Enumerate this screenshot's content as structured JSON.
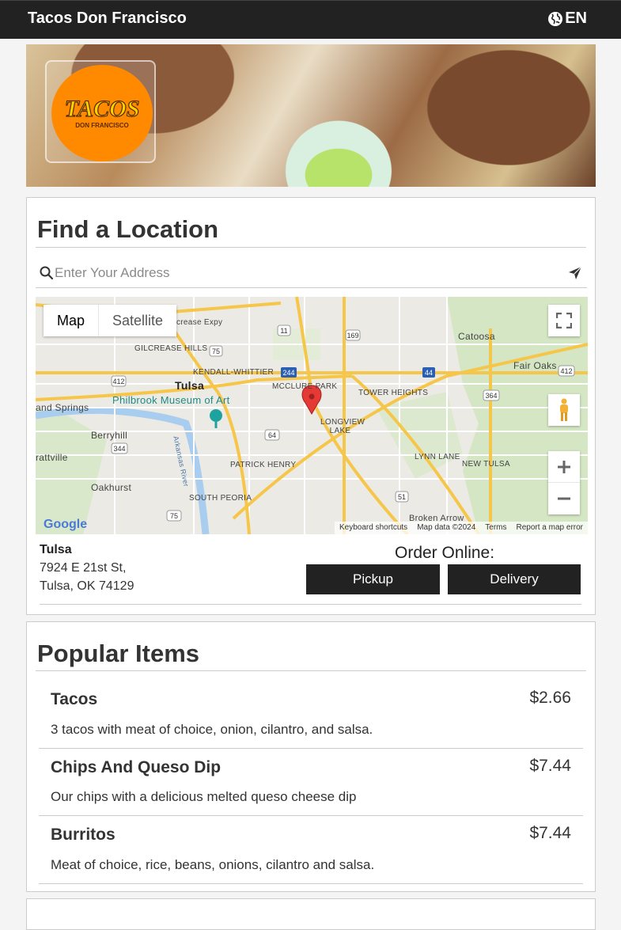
{
  "header": {
    "brand": "Tacos Don Francisco",
    "language": "EN",
    "language_icon": "globe-icon"
  },
  "hero": {
    "logo_text": "TACOS",
    "logo_subtext": "DON FRANCISCO"
  },
  "locator": {
    "title": "Find a Location",
    "search_placeholder": "Enter Your Address",
    "map": {
      "type_buttons": [
        "Map",
        "Satellite"
      ],
      "active_type": "Map",
      "labels": [
        "Tulsa",
        "Catoosa",
        "Fair Oaks",
        "Philbrook Museum of Art",
        "Berryhill",
        "Oakhurst",
        "KENDALL-WHITTIER",
        "MCCLURE PARK",
        "TOWER HEIGHTS",
        "LONGVIEW LAKE",
        "LYNN LANE",
        "NEW TULSA",
        "PATRICK HENRY",
        "SOUTH PEORIA",
        "GILCREASE HILLS",
        "Broken Arrow",
        "and Springs",
        "rattville",
        "Arkansas River",
        "crease Expy"
      ],
      "attribution": [
        "Keyboard shortcuts",
        "Map data ©2024",
        "Terms",
        "Report a map error"
      ],
      "google": "Google"
    },
    "location": {
      "name": "Tulsa",
      "street": "7924 E 21st St,",
      "city_line": "Tulsa, OK 74129"
    },
    "order": {
      "label": "Order Online:",
      "pickup": "Pickup",
      "delivery": "Delivery"
    }
  },
  "popular": {
    "title": "Popular Items",
    "items": [
      {
        "name": "Tacos",
        "price": "$2.66",
        "description": "3 tacos with meat of choice, onion, cilantro, and salsa."
      },
      {
        "name": "Chips And Queso Dip",
        "price": "$7.44",
        "description": "Our chips with a delicious melted queso cheese dip"
      },
      {
        "name": "Burritos",
        "price": "$7.44",
        "description": "Meat of choice, rice, beans, onions, cilantro and salsa."
      }
    ]
  },
  "colors": {
    "header_bg": "#222222",
    "logo_orange": "#ff8a00",
    "button_dark": "#222222",
    "map_pin": "#e53935"
  }
}
